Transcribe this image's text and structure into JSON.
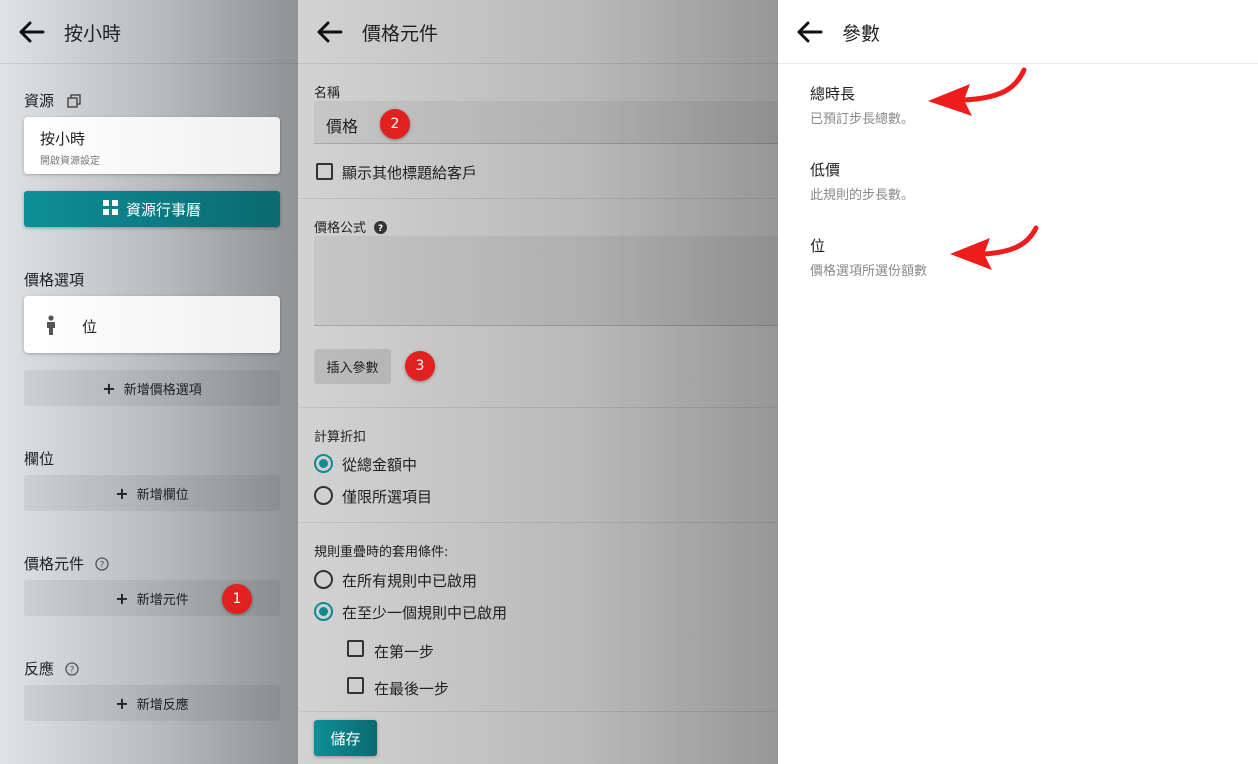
{
  "left_panel": {
    "title": "按小時",
    "resource_label": "資源",
    "resource_card": {
      "title": "按小時",
      "subtitle": "開啟資源設定"
    },
    "calendar_button": "資源行事曆",
    "price_options_label": "價格選項",
    "price_option_item": "位",
    "add_price_option": "新增價格選項",
    "fields_label": "欄位",
    "add_field": "新增欄位",
    "price_components_label": "價格元件",
    "add_component": "新增元件",
    "reactions_label": "反應",
    "add_reaction": "新增反應",
    "badge_1": "1"
  },
  "middle_panel": {
    "title": "價格元件",
    "name_label": "名稱",
    "name_value": "價格",
    "badge_2": "2",
    "show_other_title": "顯示其他標題給客戶",
    "formula_label": "價格公式",
    "formula_value": "",
    "insert_param_button": "插入參數",
    "badge_3": "3",
    "discount_label": "計算折扣",
    "discount_options": [
      "從總金額中",
      "僅限所選項目"
    ],
    "overlap_label": "規則重疊時的套用條件:",
    "overlap_options": [
      "在所有規則中已啟用",
      "在至少一個規則中已啟用"
    ],
    "step_checks": [
      "在第一步",
      "在最後一步"
    ],
    "save_button": "儲存"
  },
  "right_panel": {
    "title": "參數",
    "params": [
      {
        "name": "總時長",
        "desc": "已預訂步長總數。"
      },
      {
        "name": "低價",
        "desc": "此規則的步長數。"
      },
      {
        "name": "位",
        "desc": "價格選項所選份額數"
      }
    ]
  },
  "colors": {
    "accent_teal": "#0f8a93",
    "badge_red": "#e1211f",
    "arrow_red": "#ee1c1c"
  },
  "icons": [
    "back-arrow-icon",
    "copy-icon",
    "grid-icon",
    "person-icon",
    "plus-icon",
    "help-icon",
    "red-arrow-icon"
  ]
}
